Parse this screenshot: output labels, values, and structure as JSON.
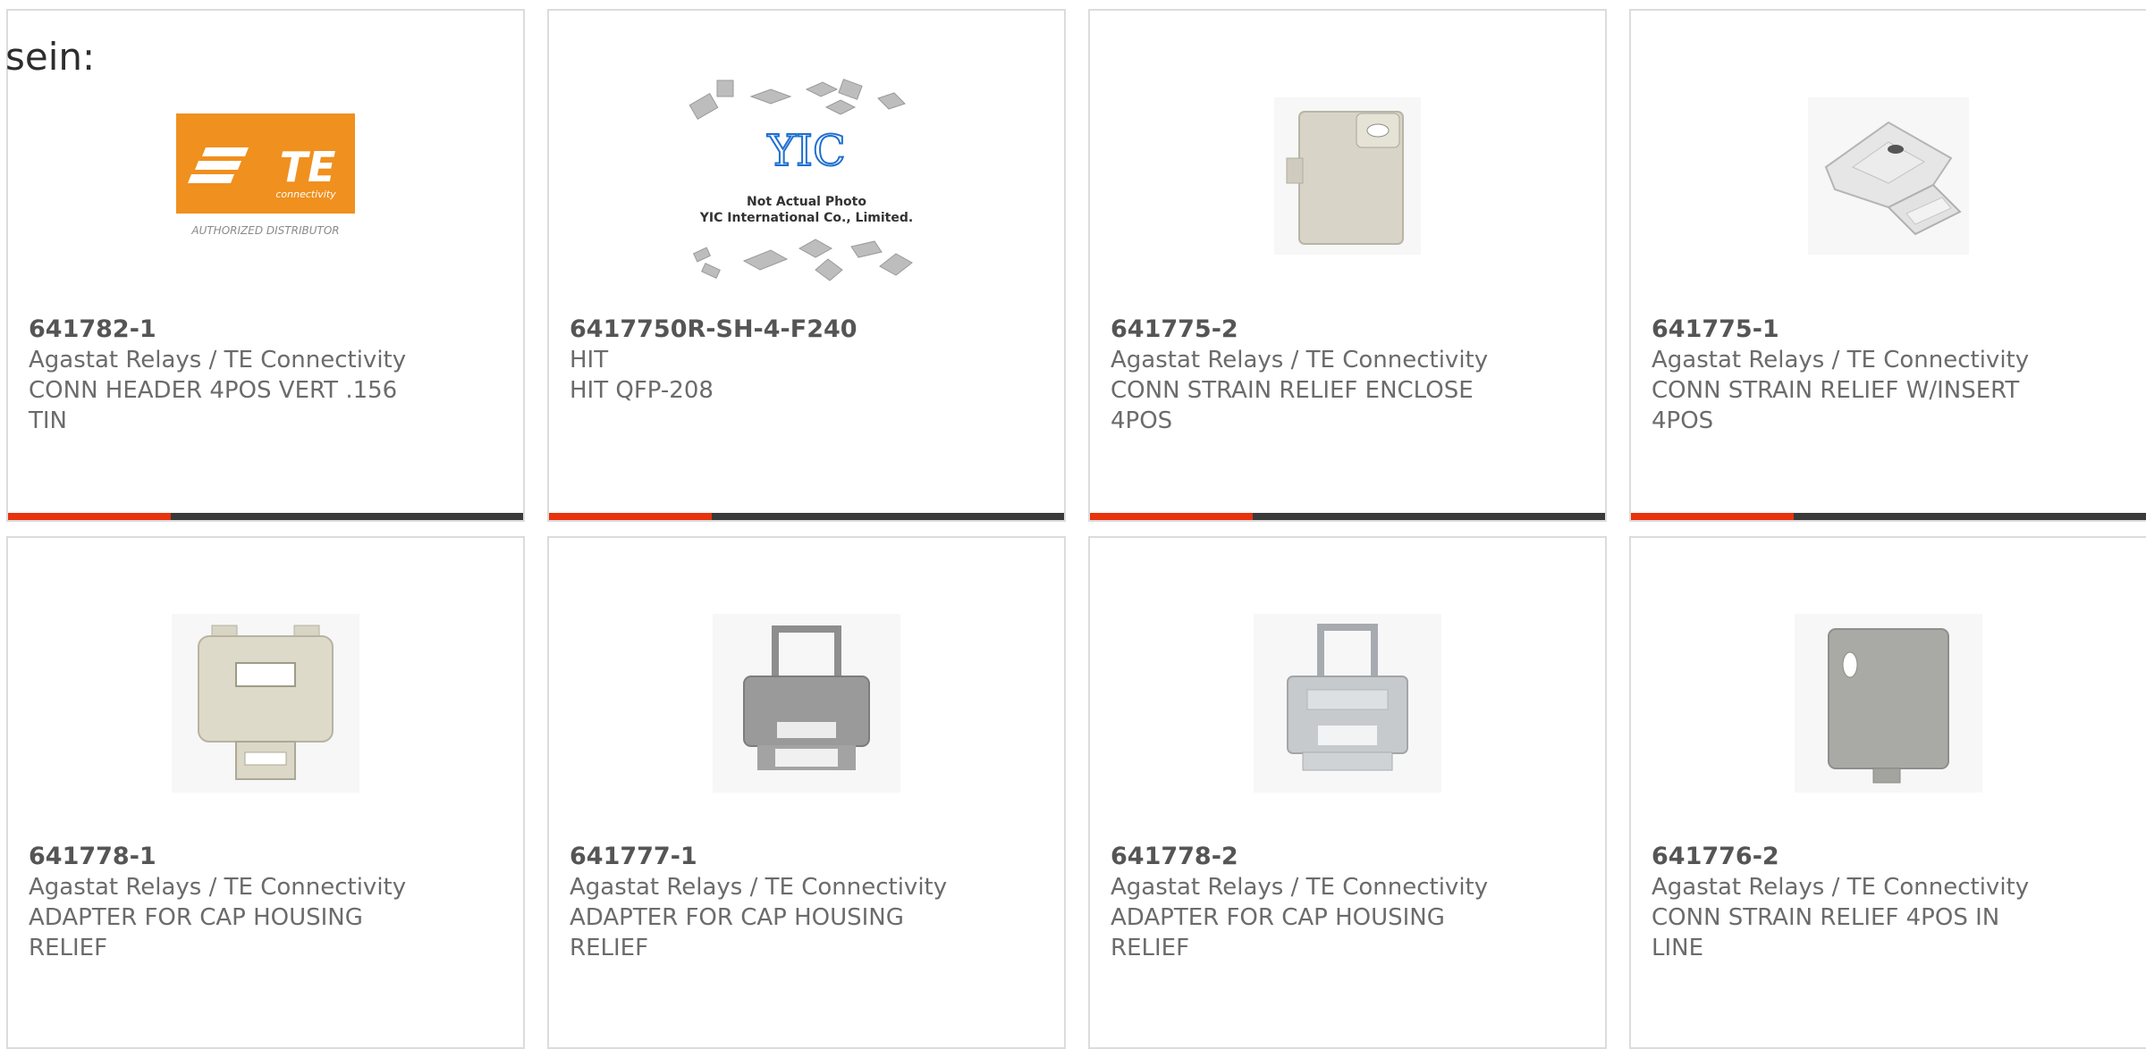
{
  "lead_text": "sein:",
  "accent_color": "#e8330f",
  "bar_color": "#3a3a3a",
  "products": [
    {
      "part": "641782-1",
      "mfr": "Agastat Relays / TE Connectivity",
      "desc": "CONN HEADER 4POS VERT .156 TIN",
      "image": "te-logo-image",
      "logo": {
        "brand": "TE",
        "sub": "connectivity",
        "caption": "AUTHORIZED DISTRIBUTOR"
      }
    },
    {
      "part": "6417750R-SH-4-F240",
      "mfr": "HIT",
      "desc": "HIT QFP-208",
      "image": "placeholder-chips-image",
      "placeholder": {
        "logo": "YIC",
        "line1": "Not Actual Photo",
        "line2": "YIC International Co., Limited."
      }
    },
    {
      "part": "641775-2",
      "mfr": "Agastat Relays / TE Connectivity",
      "desc": "CONN STRAIN RELIEF ENCLOSE 4POS",
      "image": "strain-relief-enclosed-image"
    },
    {
      "part": "641775-1",
      "mfr": "Agastat Relays / TE Connectivity",
      "desc": "CONN STRAIN RELIEF W/INSERT 4POS",
      "image": "strain-relief-insert-image"
    },
    {
      "part": "641778-1",
      "mfr": "Agastat Relays / TE Connectivity",
      "desc": "ADAPTER FOR CAP HOUSING RELIEF",
      "image": "cap-adapter-beige-image"
    },
    {
      "part": "641777-1",
      "mfr": "Agastat Relays / TE Connectivity",
      "desc": "ADAPTER FOR CAP HOUSING RELIEF",
      "image": "cap-adapter-gray-image"
    },
    {
      "part": "641778-2",
      "mfr": "Agastat Relays / TE Connectivity",
      "desc": "ADAPTER FOR CAP HOUSING RELIEF",
      "image": "cap-adapter-light-image"
    },
    {
      "part": "641776-2",
      "mfr": "Agastat Relays / TE Connectivity",
      "desc": "CONN STRAIN RELIEF 4POS IN LINE",
      "image": "strain-relief-inline-image"
    }
  ]
}
